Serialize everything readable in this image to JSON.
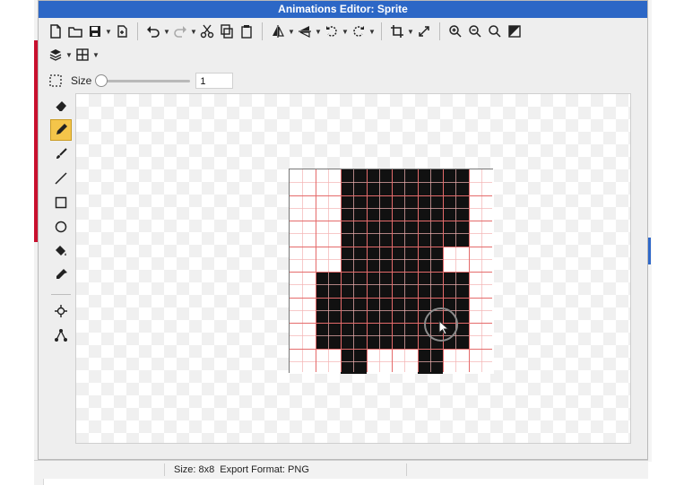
{
  "window": {
    "title": "Animations Editor: Sprite"
  },
  "toolbar": {
    "size_label": "Size",
    "size_value": "1",
    "slider_value": 1
  },
  "sprite": {
    "width": 8,
    "height": 8,
    "pixels": [
      [
        0,
        0,
        1,
        1,
        1,
        1,
        1,
        0
      ],
      [
        0,
        0,
        1,
        1,
        1,
        1,
        1,
        0
      ],
      [
        0,
        0,
        1,
        1,
        1,
        1,
        1,
        0
      ],
      [
        0,
        0,
        1,
        1,
        1,
        1,
        0,
        0
      ],
      [
        0,
        1,
        1,
        1,
        1,
        1,
        1,
        0
      ],
      [
        0,
        1,
        1,
        1,
        1,
        1,
        1,
        0
      ],
      [
        0,
        1,
        1,
        1,
        1,
        1,
        1,
        0
      ],
      [
        0,
        0,
        1,
        0,
        0,
        1,
        0,
        0
      ]
    ],
    "colors": {
      "filled": "#111111",
      "empty": "#ffffff",
      "grid_major": "#e56b6b"
    }
  },
  "status": {
    "size_text": "Size: 8x8",
    "format_text": "Export Format: PNG"
  },
  "icons": {
    "toolbar": [
      "new-file-icon",
      "open-folder-icon",
      "save-icon",
      "export-icon",
      "undo-icon",
      "redo-icon",
      "cut-icon",
      "copy-icon",
      "paste-icon",
      "flip-horizontal-icon",
      "flip-vertical-icon",
      "rotate-left-icon",
      "rotate-right-icon",
      "crop-icon",
      "resize-icon",
      "zoom-in-icon",
      "zoom-out-icon",
      "zoom-fit-icon",
      "toggle-background-icon",
      "layers-icon",
      "grid-icon",
      "selection-icon"
    ],
    "tools": [
      "eraser-icon",
      "pencil-icon",
      "brush-icon",
      "line-icon",
      "rectangle-icon",
      "circle-icon",
      "fill-bucket-icon",
      "eyedropper-icon",
      "pivot-icon",
      "nodes-icon"
    ]
  }
}
